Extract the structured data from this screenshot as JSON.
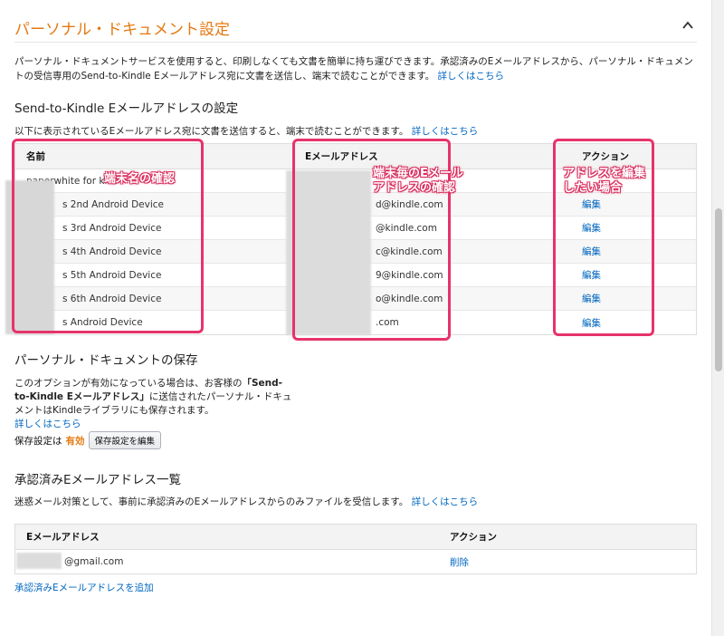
{
  "section": {
    "title": "パーソナル・ドキュメント設定",
    "intro": "パーソナル・ドキュメントサービスを使用すると、印刷しなくても文書を簡単に持ち運びできます。承認済みのEメールアドレスから、パーソナル・ドキュメントの受信専用のSend-to-Kindle Eメールアドレス宛に文書を送信し、端末で読むことができます。",
    "intro_link": "詳しくはこちら"
  },
  "send_to_kindle": {
    "heading": "Send-to-Kindle Eメールアドレスの設定",
    "desc": "以下に表示されているEメールアドレス宛に文書を送信すると、端末で読むことができます。",
    "desc_link": "詳しくはこちら",
    "columns": {
      "name": "名前",
      "email": "Eメールアドレス",
      "action": "アクション"
    },
    "rows": [
      {
        "name": "paperwhite for kids",
        "email": "",
        "action": ""
      },
      {
        "name": "s 2nd Android Device",
        "email": "d@kindle.com",
        "action": "編集"
      },
      {
        "name": "s 3rd Android Device",
        "email": "@kindle.com",
        "action": "編集"
      },
      {
        "name": "s 4th Android Device",
        "email": "c@kindle.com",
        "action": "編集"
      },
      {
        "name": "s 5th Android Device",
        "email": "9@kindle.com",
        "action": "編集"
      },
      {
        "name": "s 6th Android Device",
        "email": "o@kindle.com",
        "action": "編集"
      },
      {
        "name": "s Android Device",
        "email": ".com",
        "action": "編集"
      }
    ]
  },
  "annotations": {
    "name_note": "端末名の確認",
    "email_note_1": "端末毎のEメール",
    "email_note_2": "アドレスの確認",
    "action_note_1": "アドレスを編集",
    "action_note_2": "したい場合",
    "highlight_color": "#e6336b"
  },
  "personal_storage": {
    "heading": "パーソナル・ドキュメントの保存",
    "text_before": "このオプションが有効になっている場合は、お客様の",
    "text_bold": "「Send-to-Kindle Eメールアドレス」",
    "text_after": "に送信されたパーソナル・ドキュメントはKindleライブラリにも保存されます。",
    "link": "詳しくはこちら",
    "save_label": "保存設定は",
    "save_status": "有効",
    "edit_button": "保存設定を編集"
  },
  "approved": {
    "heading": "承認済みEメールアドレス一覧",
    "desc": "迷惑メール対策として、事前に承認済みのEメールアドレスからのみファイルを受信します。",
    "desc_link": "詳しくはこちら",
    "columns": {
      "email": "Eメールアドレス",
      "action": "アクション"
    },
    "rows": [
      {
        "email": "@gmail.com",
        "action": "削除"
      }
    ],
    "add_link": "承認済みEメールアドレスを追加"
  },
  "colors": {
    "accent": "#e47911",
    "link": "#0066c0"
  }
}
